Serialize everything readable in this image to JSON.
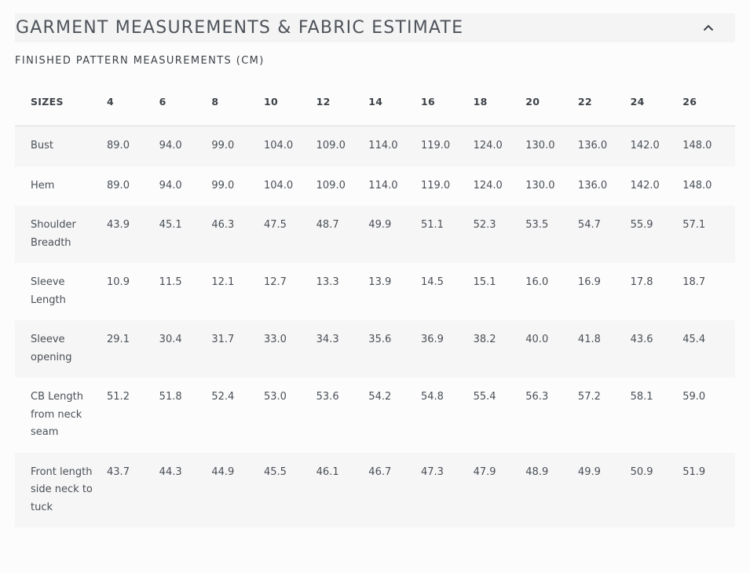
{
  "section": {
    "title": "GARMENT MEASUREMENTS & FABRIC ESTIMATE",
    "subtitle": "FINISHED PATTERN MEASUREMENTS (CM)"
  },
  "table": {
    "headers": [
      "SIZES",
      "4",
      "6",
      "8",
      "10",
      "12",
      "14",
      "16",
      "18",
      "20",
      "22",
      "24",
      "26"
    ],
    "rows": [
      {
        "label": "Bust",
        "values": [
          "89.0",
          "94.0",
          "99.0",
          "104.0",
          "109.0",
          "114.0",
          "119.0",
          "124.0",
          "130.0",
          "136.0",
          "142.0",
          "148.0"
        ]
      },
      {
        "label": "Hem",
        "values": [
          "89.0",
          "94.0",
          "99.0",
          "104.0",
          "109.0",
          "114.0",
          "119.0",
          "124.0",
          "130.0",
          "136.0",
          "142.0",
          "148.0"
        ]
      },
      {
        "label": "Shoulder Breadth",
        "values": [
          "43.9",
          "45.1",
          "46.3",
          "47.5",
          "48.7",
          "49.9",
          "51.1",
          "52.3",
          "53.5",
          "54.7",
          "55.9",
          "57.1"
        ]
      },
      {
        "label": "Sleeve Length",
        "values": [
          "10.9",
          "11.5",
          "12.1",
          "12.7",
          "13.3",
          "13.9",
          "14.5",
          "15.1",
          "16.0",
          "16.9",
          "17.8",
          "18.7"
        ]
      },
      {
        "label": "Sleeve opening",
        "values": [
          "29.1",
          "30.4",
          "31.7",
          "33.0",
          "34.3",
          "35.6",
          "36.9",
          "38.2",
          "40.0",
          "41.8",
          "43.6",
          "45.4"
        ]
      },
      {
        "label": "CB Length from neck seam",
        "values": [
          "51.2",
          "51.8",
          "52.4",
          "53.0",
          "53.6",
          "54.2",
          "54.8",
          "55.4",
          "56.3",
          "57.2",
          "58.1",
          "59.0"
        ]
      },
      {
        "label": "Front length side neck to tuck",
        "values": [
          "43.7",
          "44.3",
          "44.9",
          "45.5",
          "46.1",
          "46.7",
          "47.3",
          "47.9",
          "48.9",
          "49.9",
          "50.9",
          "51.9"
        ]
      }
    ]
  },
  "icons": {
    "collapse": "chevron-up-icon"
  }
}
